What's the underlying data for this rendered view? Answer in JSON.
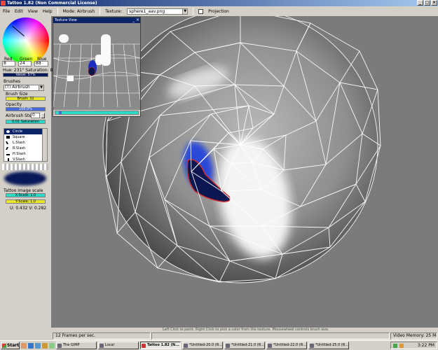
{
  "window": {
    "title": "Tattoo 1.82 (Non Commercial License)"
  },
  "menu": {
    "items": [
      "File",
      "Edit",
      "View",
      "Help"
    ],
    "mode": "Mode: Airbrush",
    "texture_label": "Texture:",
    "texture_value": "sphere1_aav.png",
    "projection_label": "Projection"
  },
  "color": {
    "red_label": "Red",
    "green_label": "Green",
    "blue_label": "Blue",
    "red": "8",
    "green": "24",
    "blue": "88",
    "hue_sat": "Hue: 231°  Saturation: 87%",
    "value_text": "Value: 57%",
    "swatch": "#081858"
  },
  "brushes": {
    "label": "Brushes",
    "selected": "(T) Airbrush",
    "size_label": "Brush Size",
    "size_value": "Brush: 32",
    "opacity_label": "Opacity",
    "opacity_value": "100.0%",
    "step_label": "Airbrush Step",
    "step_value": "0",
    "step_bar": "0.01 Saturation",
    "shapes": [
      {
        "label": "Circle",
        "icon": "circle-shape-icon"
      },
      {
        "label": "Square",
        "icon": "square-shape-icon"
      },
      {
        "label": "L.Slash",
        "icon": "left-slash-icon"
      },
      {
        "label": "R.Slash",
        "icon": "right-slash-icon"
      },
      {
        "label": "H.Slash",
        "icon": "h-slash-icon"
      },
      {
        "label": "V.Slash",
        "icon": "v-slash-icon"
      }
    ]
  },
  "tattoo": {
    "label": "Tattoo Image scale",
    "scale_x": "X-Scale: 1.0",
    "scale_y": "Y-Scale: 1.0",
    "uv": "U: 0.432  V: 0.282"
  },
  "texture_view": {
    "title": "Texture View"
  },
  "status": {
    "fps": "12 Frames per sec.",
    "hint": "Left Click to paint. Right Click to pick a color from the texture. Mousewheel controls brush size.",
    "memory": "Video Memory: 25 Meg."
  },
  "taskbar": {
    "start": "Start",
    "tasks": [
      "The GIMP",
      "Local",
      "Tattoo 1.82 (N...",
      "*Untitled-20.0 (R...",
      "*Untitled-21.0 (R...",
      "*Untitled-22.0 (R...",
      "*Untitled-25.0 (R..."
    ],
    "time": "3:22 PM"
  }
}
